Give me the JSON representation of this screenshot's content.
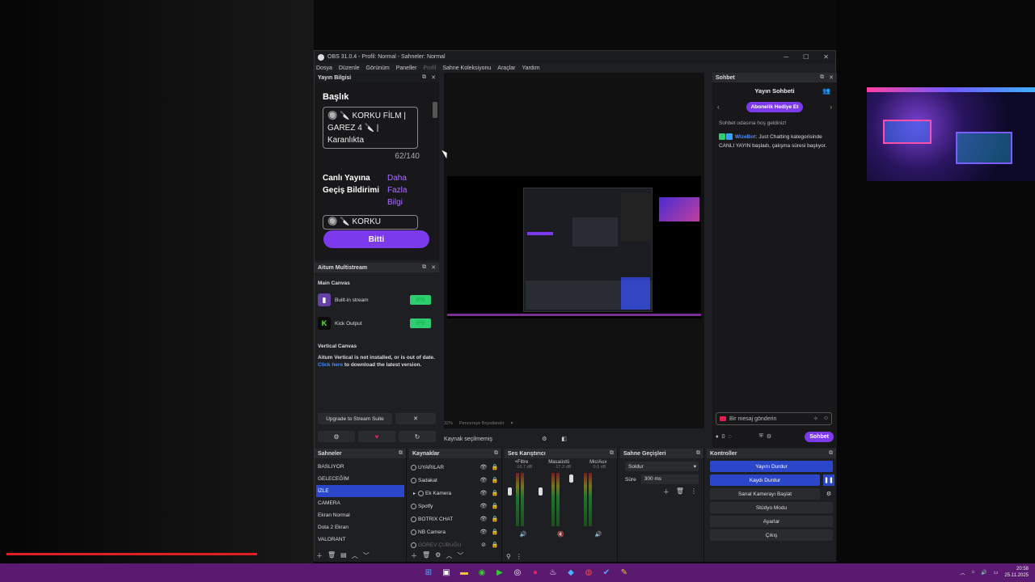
{
  "window": {
    "title": "OBS 31.0.4 - Profil: Normal - Sahneler: Normal"
  },
  "menu": [
    "Dosya",
    "Düzenle",
    "Görünüm",
    "Paneller",
    "Profil",
    "Sahne Koleksiyonu",
    "Araçlar",
    "Yardım"
  ],
  "stream_info": {
    "dock_title": "Yayın Bilgisi",
    "title_label": "Başlık",
    "title_value": "🔘 🔪 KORKU FİLM | GAREZ 4 🔪 | Karanlıkta",
    "counter": "62/140",
    "notif_label": "Canlı Yayına Geçiş Bildirimi",
    "more_info": "Daha Fazla Bilgi",
    "notif_value": "🔘 🔪 KORKU",
    "done_button": "Bitti"
  },
  "aitum": {
    "dock_title": "Aitum Multistream",
    "main_canvas": "Main Canvas",
    "outputs": [
      {
        "label": "Built-in stream",
        "icon": "twitch-icon"
      },
      {
        "label": "Kick Output",
        "icon": "kick-icon"
      }
    ],
    "vertical_canvas": "Vertical Canvas",
    "vertical_warning": "Aitum Vertical is not installed, or is out of date.",
    "click_here": "Click here",
    "download_text": " to download the latest version.",
    "upgrade_button": "Upgrade to Stream Suite",
    "close_glyph": "✕"
  },
  "preview": {
    "zoom": "32%",
    "window_fit": "Pencereye Boyutlandır",
    "source_status": "Kaynak seçilmemiş"
  },
  "chat": {
    "dock_title": "Sohbet",
    "header": "Yayın Sohbeti",
    "gift_button": "Abonelik Hediye Et",
    "welcome": "Sohbet odasına hoş geldiniz!",
    "bot_name": "WizeBot:",
    "bot_message": "Just Chatting kategorisinde CANLI YAYIN başladı, çalışma süresi başlıyor.",
    "input_placeholder": "Bir mesaj gönderin",
    "points": "0",
    "send_button": "Sohbet"
  },
  "scenes": {
    "title": "Sahneler",
    "items": [
      "BASLIYOR",
      "GELECEĞİM",
      "İZLE",
      "CAMERA",
      "Ekran Normal",
      "Dota 2 Ekran",
      "VALORANT"
    ],
    "selected_index": 2
  },
  "sources": {
    "title": "Kaynaklar",
    "items": [
      "UYARILAR",
      "Sadakat",
      "Ek Kamera",
      "Spotfy",
      "BOTRIX CHAT",
      "NB Camera",
      "GÖREV ÇUBUĞU"
    ]
  },
  "mixer": {
    "title": "Ses Karıştırıcı",
    "channels": [
      {
        "name": "+Filtre",
        "db": "-16.7 dB"
      },
      {
        "name": "Masaüstü",
        "db": "-17.3 dB"
      },
      {
        "name": "Mic/Aux",
        "db": "0.0 dB"
      }
    ]
  },
  "transitions": {
    "title": "Sahne Geçişleri",
    "selected": "Soldur",
    "duration_label": "Süre",
    "duration_value": "300 ms"
  },
  "controls": {
    "title": "Kontroller",
    "buttons": [
      "Yayını Durdur",
      "Kaydı Durdur",
      "Sanal Kamerayı Başlat",
      "Stüdyo Modu",
      "Ayarlar",
      "Çıkış"
    ]
  },
  "taskbar": {
    "time": "20:58",
    "date": "25.11.2025"
  },
  "colors": {
    "accent_purple": "#7c3aed",
    "obs_blue": "#2b46c8",
    "kick_green": "#53fc18",
    "taskbar": "#5a1a6f"
  }
}
